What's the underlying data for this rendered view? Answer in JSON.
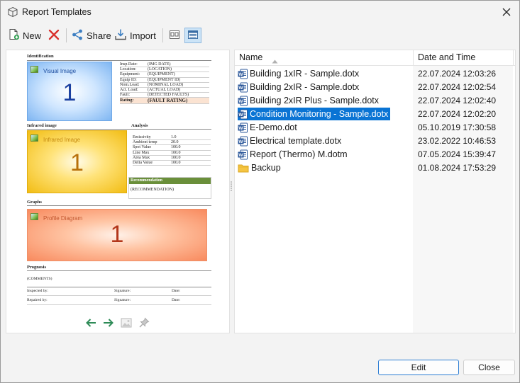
{
  "window": {
    "title": "Report Templates"
  },
  "toolbar": {
    "new_label": "New",
    "share_label": "Share",
    "import_label": "Import"
  },
  "preview": {
    "identification": "Identification",
    "visual_image_label": "Visual Image",
    "visual_image_number": "1",
    "info_rows": [
      {
        "key": "Insp.Date:",
        "value": "(IMG DATE)"
      },
      {
        "key": "Location:",
        "value": "(LOCATION)"
      },
      {
        "key": "Equipment:",
        "value": "(EQUIPMENT)"
      },
      {
        "key": "Equip ID:",
        "value": "(EQUIPMENT ID)"
      },
      {
        "key": "Nom.Load:",
        "value": "(NOMINAL LOAD)"
      },
      {
        "key": "Act. Load:",
        "value": "(ACTUAL LOAD)"
      },
      {
        "key": "Fault:",
        "value": "(DETECTED FAULTS)"
      }
    ],
    "rating_key": "Rating:",
    "rating_value": "(FAULT RATING)",
    "infrared_heading": "Infrared image",
    "infrared_label": "Infrared Image",
    "infrared_number": "1",
    "analysis_heading": "Analysis",
    "analysis_rows": [
      {
        "key": "Emissivity",
        "value": "1.0"
      },
      {
        "key": "Ambient temp",
        "value": "20.0"
      },
      {
        "key": "Spot Value",
        "value": "100.0"
      },
      {
        "key": "Line Max",
        "value": "100.0"
      },
      {
        "key": "Area Max",
        "value": "100.0"
      },
      {
        "key": "Delta Value",
        "value": "100.0"
      }
    ],
    "recommendation_heading": "Recommendation",
    "recommendation_value": "(RECOMMENDATION)",
    "graphs_heading": "Graphs",
    "profile_label": "Profile Diagram",
    "profile_number": "1",
    "prognosis_heading": "Prognosis",
    "comments": "(COMMENTS)",
    "inspected_by": "Inspected by:",
    "repaired_by": "Repaired by:",
    "signature": "Signature:",
    "date": "Date:"
  },
  "file_list": {
    "col_name": "Name",
    "col_date": "Date and Time",
    "rows": [
      {
        "name": "Building 1xIR - Sample.dotx",
        "date": "22.07.2024 12:03:26",
        "icon": "word-icon"
      },
      {
        "name": "Building 2xIR - Sample.dotx",
        "date": "22.07.2024 12:02:54",
        "icon": "word-icon"
      },
      {
        "name": "Building 2xIR Plus - Sample.dotx",
        "date": "22.07.2024 12:02:40",
        "icon": "word-icon"
      },
      {
        "name": "Condition Monitoring - Sample.dotx",
        "date": "22.07.2024 12:02:20",
        "icon": "word-icon"
      },
      {
        "name": "E-Demo.dot",
        "date": "05.10.2019 17:30:58",
        "icon": "word-icon"
      },
      {
        "name": "Electrical template.dotx",
        "date": "23.02.2022 10:46:53",
        "icon": "word-icon"
      },
      {
        "name": "Report (Thermo) M.dotm",
        "date": "07.05.2024 15:39:47",
        "icon": "word-icon"
      },
      {
        "name": "Backup",
        "date": "01.08.2024 17:53:29",
        "icon": "folder-icon"
      }
    ],
    "selected_index": 3
  },
  "buttons": {
    "edit_label": "Edit",
    "close_label": "Close"
  },
  "colors": {
    "accent": "#0a74d4",
    "word_blue": "#2b579a",
    "delete_red": "#d9302c",
    "nav_green": "#2e8b57"
  }
}
